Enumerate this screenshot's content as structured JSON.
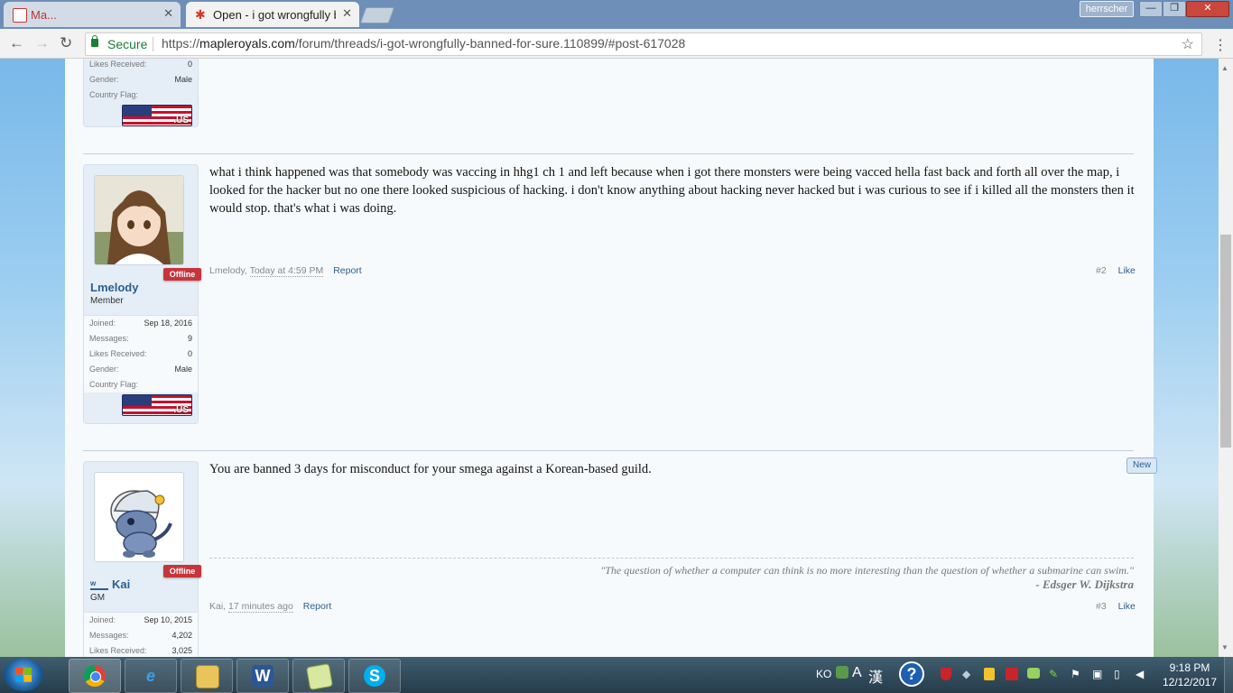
{
  "browser": {
    "tabs": [
      {
        "label": "Ma...",
        "active": false
      },
      {
        "label": "Open - i got wrongfully b",
        "active": true
      }
    ],
    "profile": "herrscher",
    "secure_label": "Secure",
    "url_prefix": "https://",
    "url_host": "mapleroyals.com",
    "url_path": "/forum/threads/i-got-wrongfully-banned-for-sure.110899/#post-617028"
  },
  "posts": [
    {
      "stats_partial": [
        {
          "k": "Likes Received:",
          "v": "0"
        },
        {
          "k": "Gender:",
          "v": "Male"
        },
        {
          "k": "Country Flag:",
          "v": ""
        }
      ]
    },
    {
      "username": "Lmelody",
      "user_title": "Member",
      "status": "Offline",
      "stats": [
        {
          "k": "Joined:",
          "v": "Sep 18, 2016"
        },
        {
          "k": "Messages:",
          "v": "9"
        },
        {
          "k": "Likes Received:",
          "v": "0"
        },
        {
          "k": "Gender:",
          "v": "Male"
        },
        {
          "k": "Country Flag:",
          "v": ""
        }
      ],
      "message": "what i think happened was that somebody was vaccing in hhg1 ch 1 and left because when i got there monsters were being vacced hella fast back and forth all over the map, i looked for the hacker but no one there looked suspicious of hacking. i don't know anything about hacking never hacked but i was curious to see if i killed all the monsters then it would stop. that's what i was doing.",
      "meta_user": "Lmelody,",
      "meta_date": "Today at 4:59 PM",
      "report": "Report",
      "post_number": "#2",
      "like": "Like"
    },
    {
      "username": "Kai",
      "user_title": "GM",
      "status": "Offline",
      "stats": [
        {
          "k": "Joined:",
          "v": "Sep 10, 2015"
        },
        {
          "k": "Messages:",
          "v": "4,202"
        },
        {
          "k": "Likes Received:",
          "v": "3,025"
        }
      ],
      "message": "You are banned 3 days for misconduct for your smega against a Korean-based guild.",
      "new_badge": "New",
      "signature_quote": "\"The question of whether a computer can think is no more interesting than the question of whether a submarine can swim.\"",
      "signature_author": "- Edsger W. Dijkstra",
      "meta_user": "Kai,",
      "meta_date": "17 minutes ago",
      "report": "Report",
      "post_number": "#3",
      "like": "Like"
    }
  ],
  "flag_label": ".US",
  "taskbar": {
    "ime": "KO",
    "ime_mode_a": "A",
    "ime_mode_b": "漢",
    "help": "?",
    "time": "9:18 PM",
    "date": "12/12/2017"
  }
}
